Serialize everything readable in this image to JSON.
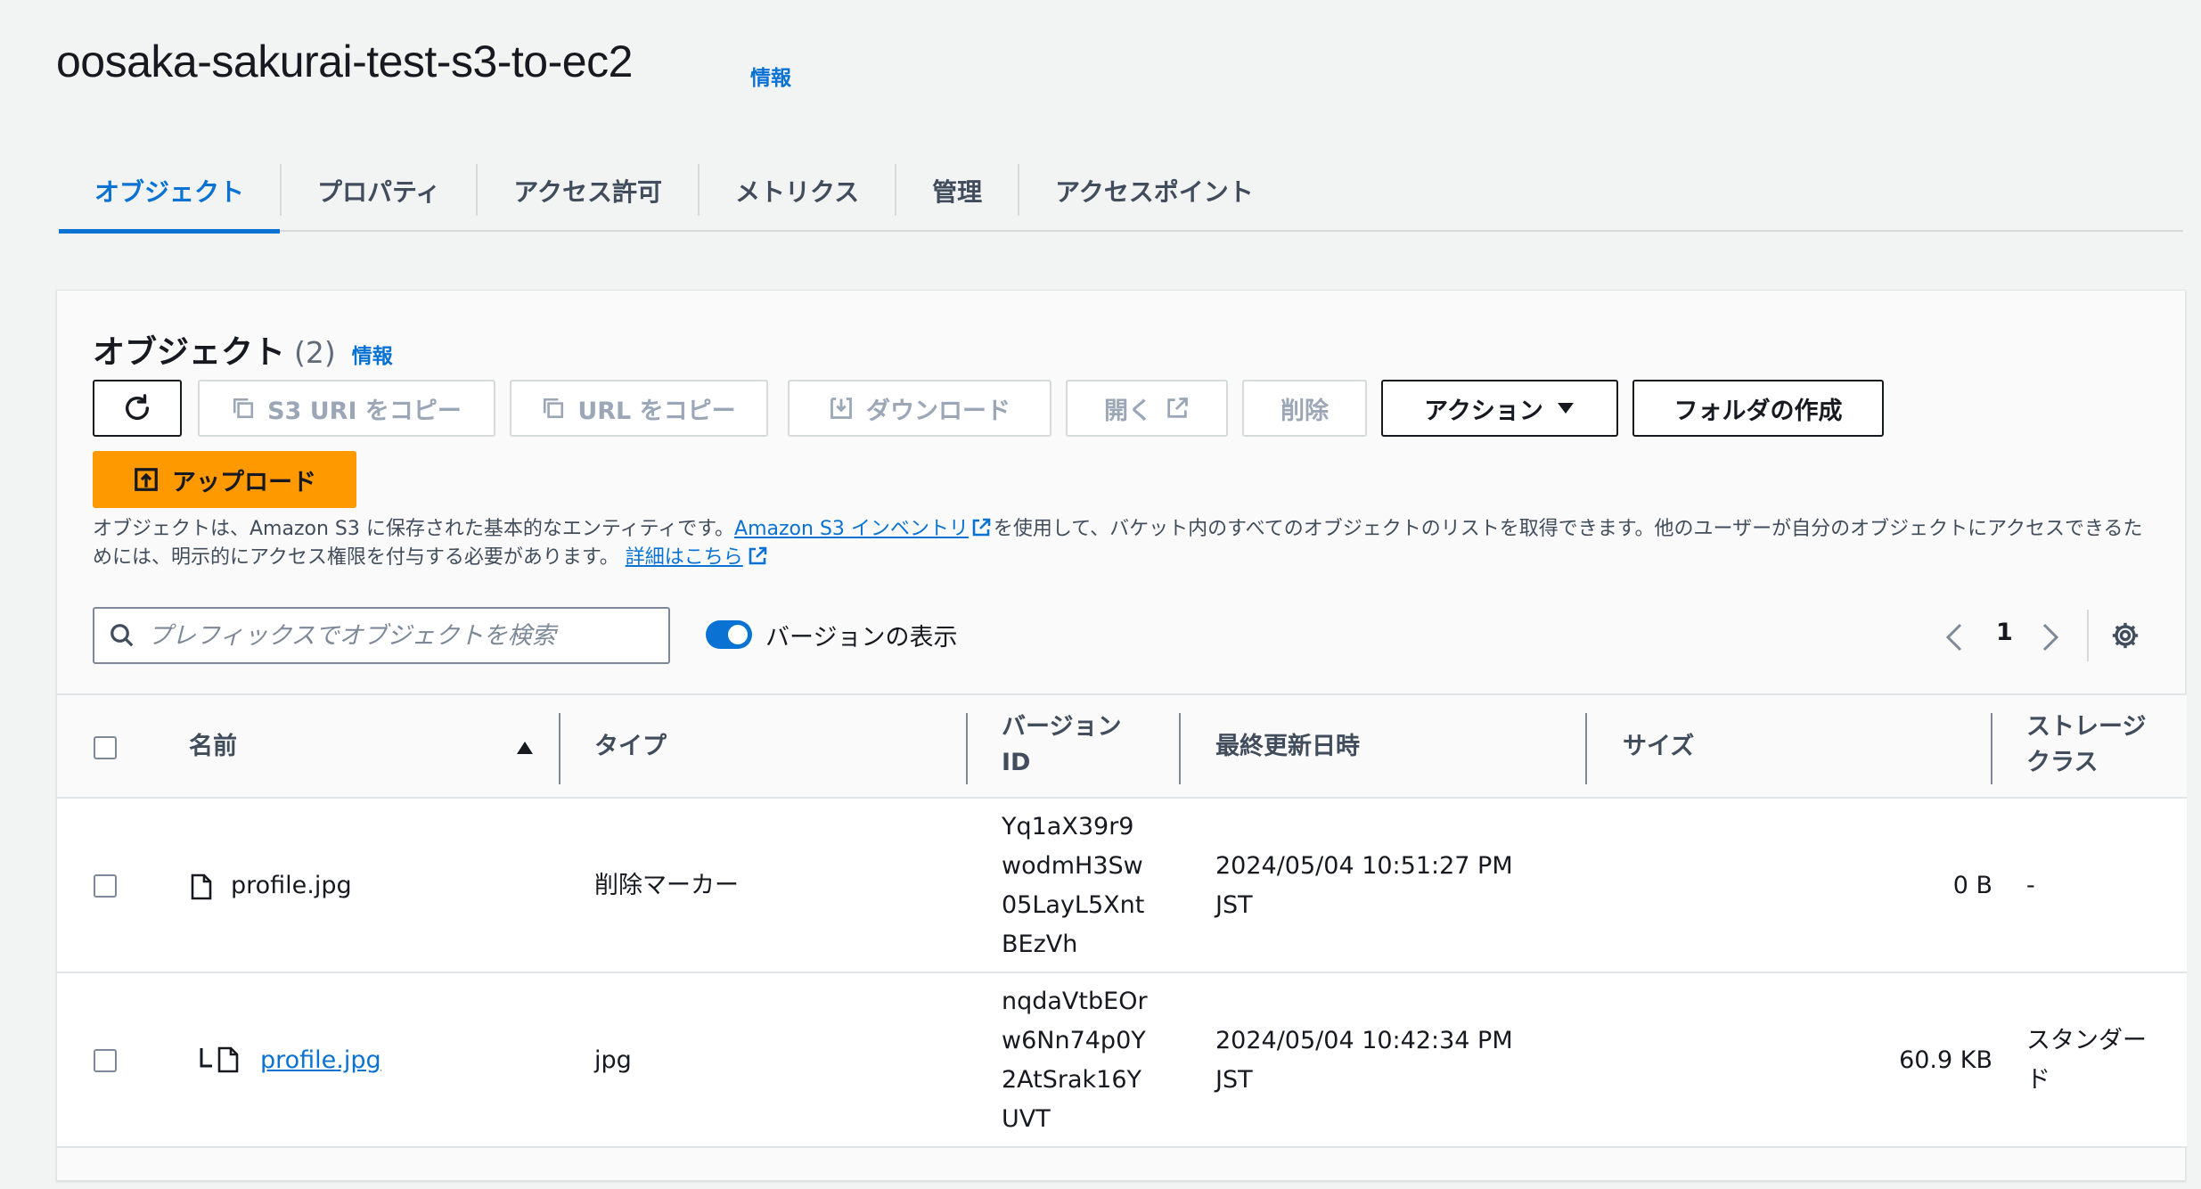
{
  "bucket": {
    "title": "oosaka-sakurai-test-s3-to-ec2",
    "info": "情報"
  },
  "tabs": [
    {
      "label": "オブジェクト"
    },
    {
      "label": "プロパティ"
    },
    {
      "label": "アクセス許可"
    },
    {
      "label": "メトリクス"
    },
    {
      "label": "管理"
    },
    {
      "label": "アクセスポイント"
    }
  ],
  "panel": {
    "title": "オブジェクト",
    "count": "(2)",
    "info": "情報",
    "buttons": {
      "copy_s3_uri": "S3 URI をコピー",
      "copy_url": "URL をコピー",
      "download": "ダウンロード",
      "open": "開く",
      "delete": "削除",
      "actions": "アクション",
      "create_folder": "フォルダの作成",
      "upload": "アップロード"
    },
    "description": {
      "part1": "オブジェクトは、Amazon S3 に保存された基本的なエンティティです。",
      "link1": "Amazon S3 インベントリ",
      "part2": "を使用して、バケット内のすべてのオブジェクトのリストを取得できます。他のユーザーが自分のオブジェクトにアクセスできるためには、明示的にアクセス権限を付与する必要があります。",
      "link2": "詳細はこちら"
    },
    "search_placeholder": "プレフィックスでオブジェクトを検索",
    "version_toggle_label": "バージョンの表示",
    "page_number": "1"
  },
  "table": {
    "columns": {
      "name": "名前",
      "type": "タイプ",
      "version_id_1": "バージョン",
      "version_id_2": "ID",
      "last_modified": "最終更新日時",
      "size": "サイズ",
      "storage_class_1": "ストレージ",
      "storage_class_2": "クラス"
    },
    "rows": [
      {
        "name": "profile.jpg",
        "type": "削除マーカー",
        "version_lines": [
          "Yq1aX39r9",
          "wodmH3Sw",
          "05LayL5Xnt",
          "BEzVh"
        ],
        "modified_1": "2024/05/04 10:51:27 PM",
        "modified_2": "JST",
        "size": "0 B",
        "storage_class_1": "-",
        "storage_class_2": ""
      },
      {
        "name": "profile.jpg",
        "type": "jpg",
        "version_lines": [
          "nqdaVtbEOr",
          "w6Nn74p0Y",
          "2AtSrak16Y",
          "UVT"
        ],
        "modified_1": "2024/05/04 10:42:34 PM",
        "modified_2": "JST",
        "size": "60.9 KB",
        "storage_class_1": "スタンダー",
        "storage_class_2": "ド"
      }
    ]
  }
}
